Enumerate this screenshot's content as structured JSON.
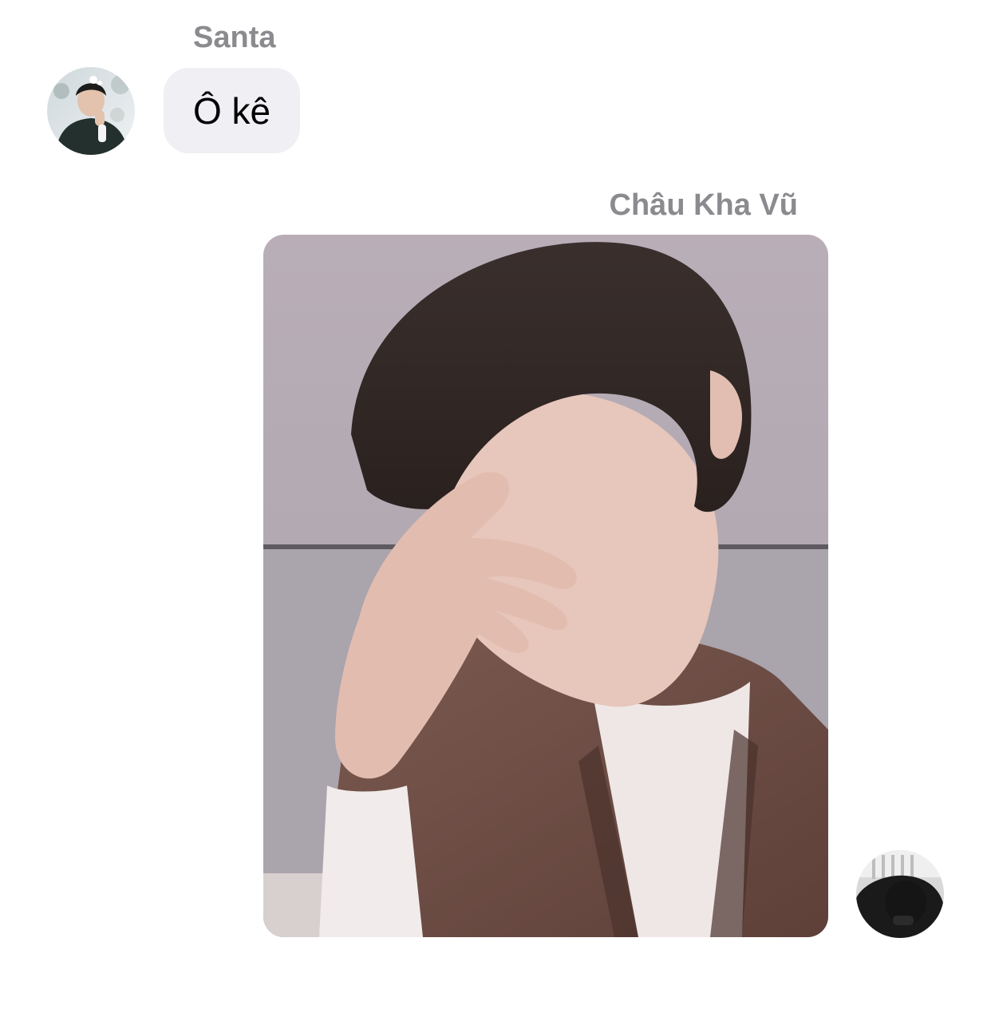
{
  "conversation": {
    "incoming": {
      "sender_name": "Santa",
      "avatar_icon": "user-avatar-winter-photo",
      "message_text": "Ô kê"
    },
    "outgoing": {
      "sender_name": "Châu Kha Vũ",
      "avatar_icon": "user-avatar-dark-photo",
      "attachment_icon": "photo-attachment"
    }
  },
  "colors": {
    "background": "#ffffff",
    "sender_name": "#8a8a8f",
    "incoming_bubble": "#efeff4",
    "message_text": "#000000"
  }
}
